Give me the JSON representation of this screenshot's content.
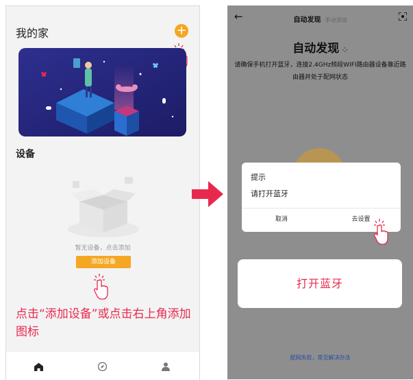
{
  "left_screen": {
    "home_title": "我的家",
    "add_icon_glyph": "+",
    "device_section_title": "设备",
    "empty_text": "暂无设备，点击添加",
    "add_device_button": "添加设备",
    "instruction": "点击“添加设备”或点击右上角添加图标",
    "tabs": [
      {
        "icon": "home-icon"
      },
      {
        "icon": "compass-icon"
      },
      {
        "icon": "person-icon"
      }
    ]
  },
  "right_screen": {
    "nav_title": "自动发现",
    "nav_subtitle": "手动添加",
    "hero_title": "自动发现",
    "hero_description": "请确保手机打开蓝牙，连接2.4GHz频段WIFI路由器设备靠近路由器并处于配网状态",
    "dialog": {
      "title": "提示",
      "message": "请打开蓝牙",
      "cancel": "取消",
      "settings": "去设置"
    },
    "bluetooth_button": "打开蓝牙",
    "help_link": "配网失败，常见解决办法"
  },
  "colors": {
    "accent_orange": "#f5a623",
    "instruction_red": "#e8294e",
    "overlay_gray": "#8e8e8e",
    "link_blue": "#2b4aa6"
  }
}
